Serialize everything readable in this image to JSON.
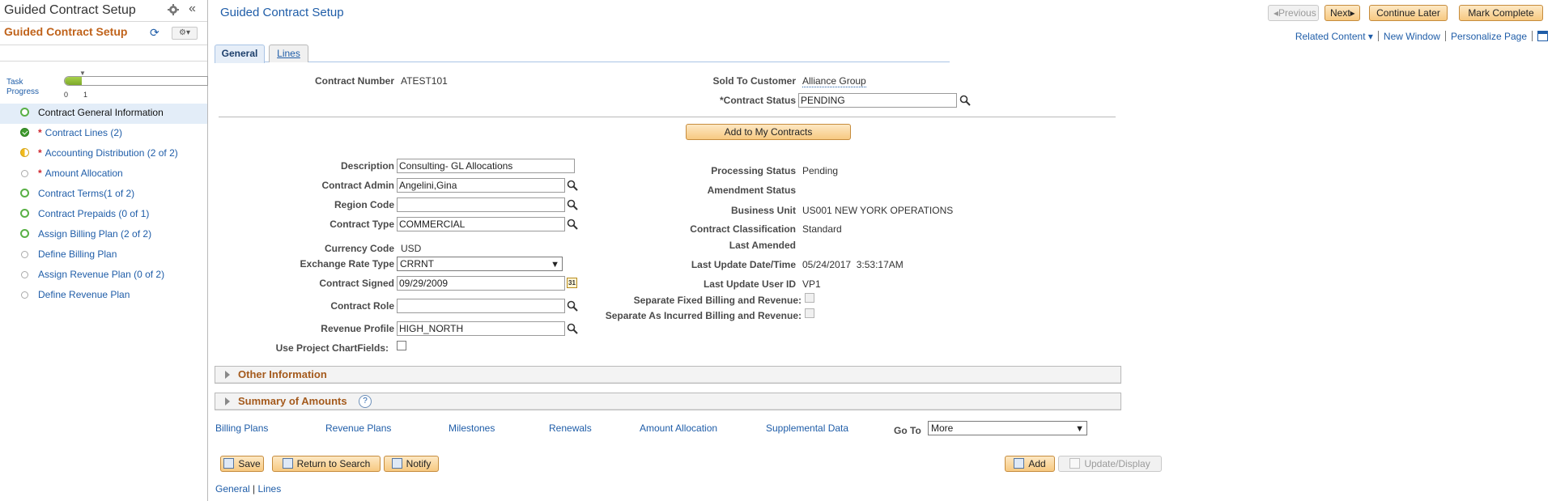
{
  "left_panel": {
    "title": "Guided Contract Setup",
    "subtitle": "Guided Contract Setup",
    "collapse_glyph": "«",
    "refresh_glyph": "⟳",
    "actions_glyph": "⚙▾",
    "task_progress": {
      "label": "Task Progress",
      "fraction": 0.12,
      "ticks": [
        "0",
        "1"
      ]
    },
    "steps": [
      {
        "label": "Contract General Information",
        "status": "open",
        "required": false,
        "active": true
      },
      {
        "label": "Contract Lines (2)",
        "status": "done",
        "required": true,
        "active": false
      },
      {
        "label": "Accounting Distribution (2 of 2)",
        "status": "partial",
        "required": true,
        "active": false
      },
      {
        "label": "Amount Allocation",
        "status": "none",
        "required": true,
        "active": false
      },
      {
        "label": "Contract Terms(1 of 2)",
        "status": "open",
        "required": false,
        "active": false
      },
      {
        "label": "Contract Prepaids (0 of 1)",
        "status": "open",
        "required": false,
        "active": false
      },
      {
        "label": "Assign Billing Plan (2 of 2)",
        "status": "open",
        "required": false,
        "active": false
      },
      {
        "label": "Define Billing Plan",
        "status": "none",
        "required": false,
        "active": false
      },
      {
        "label": "Assign Revenue Plan (0 of 2)",
        "status": "none",
        "required": false,
        "active": false
      },
      {
        "label": "Define Revenue Plan",
        "status": "none",
        "required": false,
        "active": false
      }
    ],
    "required_marker": "*"
  },
  "header": {
    "page_title": "Guided Contract Setup",
    "previous_label": "◂Previous",
    "next_label": "Next▸",
    "continue_later_label": "Continue Later",
    "mark_complete_label": "Mark Complete",
    "related_content_label": "Related Content ▾",
    "new_window_label": "New Window",
    "personalize_label": "Personalize Page"
  },
  "tabs": {
    "general": "General",
    "lines": "Lines"
  },
  "form": {
    "contract_number_label": "Contract Number",
    "contract_number": "ATEST101",
    "sold_to_label": "Sold To Customer",
    "sold_to": "Alliance Group",
    "contract_status_label": "*Contract Status",
    "contract_status": "PENDING",
    "add_to_my_contracts": "Add to My Contracts",
    "description_label": "Description",
    "description": "Consulting- GL Allocations",
    "contract_admin_label": "Contract Admin",
    "contract_admin": "Angelini,Gina",
    "region_code_label": "Region Code",
    "region_code": "",
    "contract_type_label": "Contract Type",
    "contract_type": "COMMERCIAL",
    "currency_code_label": "Currency Code",
    "currency_code": "USD",
    "exchange_rate_label": "Exchange Rate Type",
    "exchange_rate": "CRRNT",
    "contract_signed_label": "Contract Signed",
    "contract_signed": "09/29/2009",
    "contract_role_label": "Contract Role",
    "contract_role": "",
    "revenue_profile_label": "Revenue Profile",
    "revenue_profile": "HIGH_NORTH",
    "use_project_label": "Use Project ChartFields:",
    "use_project_checked": false,
    "processing_status_label": "Processing Status",
    "processing_status": "Pending",
    "amendment_status_label": "Amendment Status",
    "amendment_status": "",
    "business_unit_label": "Business Unit",
    "business_unit": "US001 NEW YORK OPERATIONS",
    "classification_label": "Contract Classification",
    "classification": "Standard",
    "last_amended_label": "Last Amended",
    "last_amended": "",
    "last_update_dt_label": "Last Update Date/Time",
    "last_update_dt": "05/24/2017  3:53:17AM",
    "last_update_user_label": "Last Update User ID",
    "last_update_user": "VP1",
    "sep_fixed_label": "Separate Fixed Billing and Revenue:",
    "sep_incurred_label": "Separate As Incurred Billing and Revenue:",
    "calendar_glyph": "31"
  },
  "sections": {
    "other_information": "Other Information",
    "summary_of_amounts": "Summary of Amounts",
    "help_glyph": "?"
  },
  "bottom_links": {
    "billing_plans": "Billing Plans",
    "revenue_plans": "Revenue Plans",
    "milestones": "Milestones",
    "renewals": "Renewals",
    "amount_allocation": "Amount Allocation",
    "supplemental_data": "Supplemental Data",
    "goto_label": "Go To",
    "goto_value": "More"
  },
  "toolbar": {
    "save": "Save",
    "return_to_search": "Return to Search",
    "notify": "Notify",
    "add": "Add",
    "update_display": "Update/Display"
  },
  "footer": {
    "general": "General",
    "separator": " | ",
    "lines": "Lines"
  },
  "colors": {
    "link": "#1f5da8",
    "section_title": "#a45a1d",
    "subtitle": "#c0631b",
    "progress": "#8dbb36",
    "required": "#d0242b"
  }
}
